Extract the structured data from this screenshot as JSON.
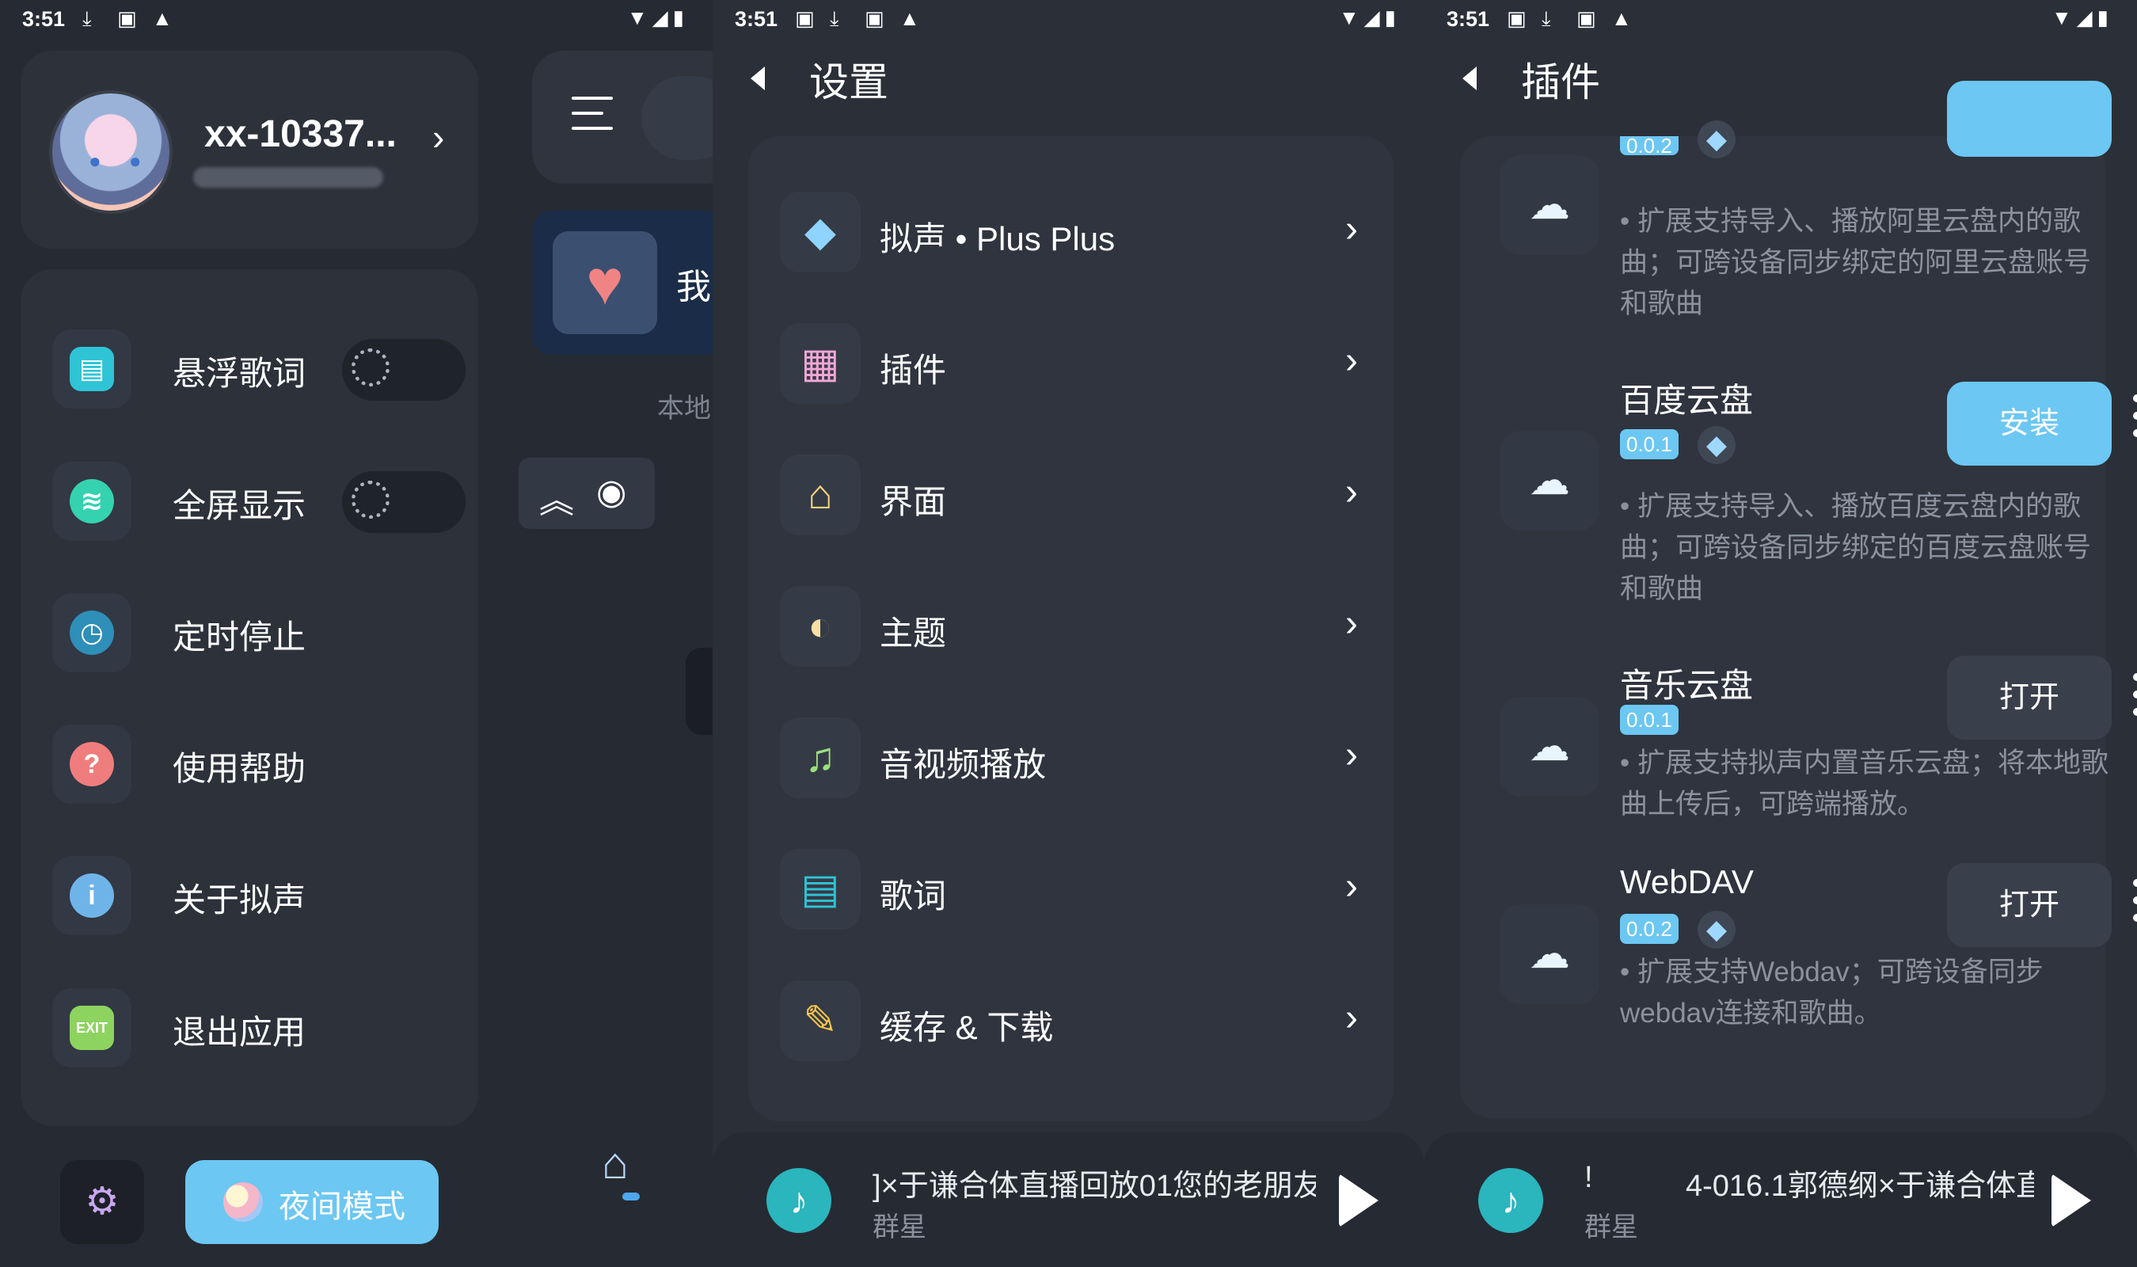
{
  "status_bars": [
    {
      "time": "3:51"
    },
    {
      "time": "3:51"
    },
    {
      "time": "3:51"
    }
  ],
  "drawer": {
    "username": "xx-10337...",
    "menu": [
      {
        "label": "悬浮歌词",
        "icon": "lyrics-icon",
        "toggle": "off"
      },
      {
        "label": "全屏显示",
        "icon": "fullscreen-icon",
        "toggle": "off"
      },
      {
        "label": "定时停止",
        "icon": "timer-icon"
      },
      {
        "label": "使用帮助",
        "icon": "help-icon"
      },
      {
        "label": "关于拟声",
        "icon": "info-icon"
      },
      {
        "label": "退出应用",
        "icon": "exit-icon"
      }
    ],
    "night_mode_label": "夜间模式",
    "home_peek": {
      "card_label": "我",
      "local_label": "本地"
    }
  },
  "settings": {
    "title": "设置",
    "items": [
      {
        "label": "拟声 • Plus Plus",
        "icon": "diamond-icon"
      },
      {
        "label": "插件",
        "icon": "plugin-blocks-icon"
      },
      {
        "label": "界面",
        "icon": "paint-roller-icon"
      },
      {
        "label": "主题",
        "icon": "theme-icon"
      },
      {
        "label": "音视频播放",
        "icon": "music-notes-icon"
      },
      {
        "label": "歌词",
        "icon": "lyrics-icon"
      },
      {
        "label": "缓存 & 下载",
        "icon": "broom-icon"
      }
    ],
    "player": {
      "title": "]×于谦合体直播回放01您的老朋友",
      "artist": "群星"
    }
  },
  "plugins": {
    "title": "插件",
    "top_partial": {
      "version": "0.0.2",
      "desc": "• 扩展支持导入、播放阿里云盘内的歌曲；可跨设备同步绑定的阿里云盘账号和歌曲"
    },
    "items": [
      {
        "name": "百度云盘",
        "version": "0.0.1",
        "premium": true,
        "action": "安装",
        "desc": "• 扩展支持导入、播放百度云盘内的歌曲；可跨设备同步绑定的百度云盘账号和歌曲"
      },
      {
        "name": "音乐云盘",
        "version": "0.0.1",
        "premium": false,
        "action": "打开",
        "desc": "• 扩展支持拟声内置音乐云盘；将本地歌曲上传后，可跨端播放。"
      },
      {
        "name": "WebDAV",
        "version": "0.0.2",
        "premium": true,
        "action": "打开",
        "desc": "• 扩展支持Webdav；可跨设备同步webdav连接和歌曲。"
      }
    ],
    "player": {
      "prefix": "!",
      "title": "4-016.1郭德纲×于谦合体直",
      "artist": "群星"
    }
  },
  "colors": {
    "accent": "#6cc7f2",
    "background": "#2b2f38",
    "card": "#2f343e"
  }
}
